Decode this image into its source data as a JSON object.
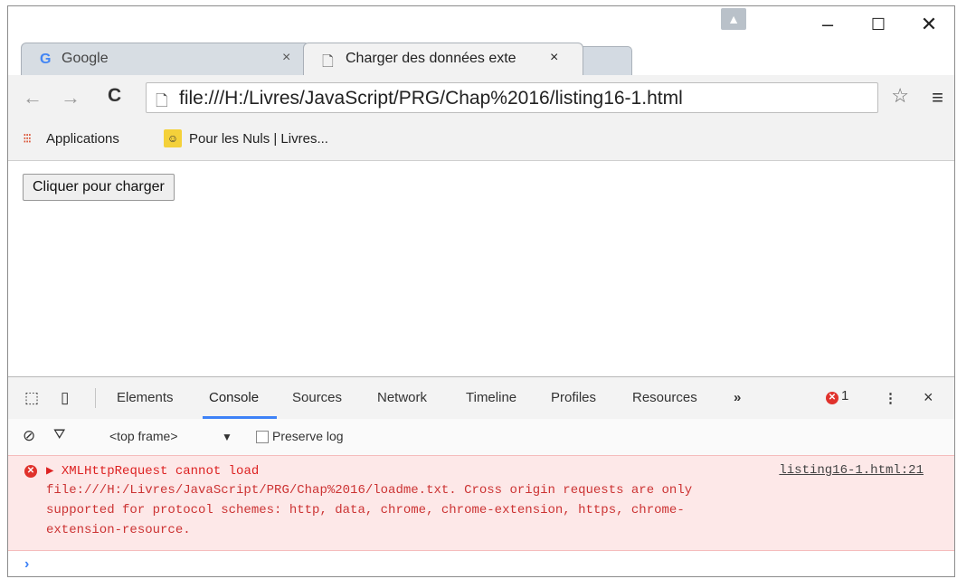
{
  "browser": {
    "tabs": [
      {
        "title": "Google",
        "icon": "google-g-icon"
      },
      {
        "title": "Charger des données exte",
        "icon": "page-icon"
      }
    ],
    "close_glyph": "×",
    "window_controls": {
      "minimize": "–",
      "maximize": "☐",
      "close": "✕"
    },
    "profile_glyph": "▲"
  },
  "toolbar": {
    "back": "←",
    "forward": "→",
    "reload": "C",
    "url": "file:///H:/Livres/JavaScript/PRG/Chap%2016/listing16-1.html",
    "star": "☆",
    "menu": "≡"
  },
  "bookmarks": {
    "items": [
      {
        "label": "Applications",
        "icon": "apps-grid-icon"
      },
      {
        "label": "Pour les Nuls | Livres...",
        "icon": "nuls-logo-icon"
      }
    ]
  },
  "page": {
    "button_label": "Cliquer pour charger"
  },
  "devtools": {
    "tabs": [
      "Elements",
      "Console",
      "Sources",
      "Network",
      "Timeline",
      "Profiles",
      "Resources"
    ],
    "active_tab": "Console",
    "more": "»",
    "error_count": "1",
    "menu": "⋮",
    "close": "×",
    "filter": {
      "context": "<top frame>",
      "dropdown": "▼",
      "preserve_log": "Preserve log"
    },
    "console": {
      "error_lines": [
        "▶ XMLHttpRequest cannot load",
        "file:///H:/Livres/JavaScript/PRG/Chap%2016/loadme.txt. Cross origin requests are only",
        "supported for protocol schemes: http, data, chrome, chrome-extension, https, chrome-",
        "extension-resource."
      ],
      "source_link": "listing16-1.html:21",
      "prompt": "›"
    },
    "colors": {
      "error": "#dd2222",
      "accent": "#3e82f7",
      "error_bg": "#fde8e8"
    }
  }
}
